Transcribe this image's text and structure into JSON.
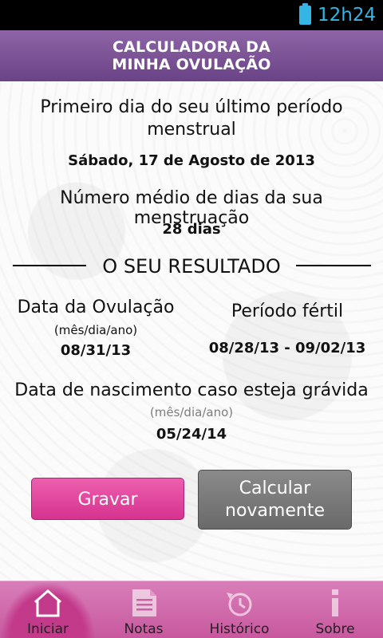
{
  "status_bar": {
    "time": "12h24"
  },
  "app": {
    "title_line1": "CALCULADORA DA",
    "title_line2": "MINHA OVULAÇÃO"
  },
  "input": {
    "last_period_label_line1": "Primeiro dia do seu último período",
    "last_period_label_line2": "menstrual",
    "last_period_value": "Sábado, 17 de Agosto de 2013",
    "cycle_label": "Número médio de dias da sua menstruação",
    "cycle_value": "28 dias"
  },
  "result": {
    "heading": "O SEU RESULTADO",
    "ovulation_label": "Data da Ovulação",
    "ovulation_format": "(mês/dia/ano)",
    "ovulation_value": "08/31/13",
    "fertile_label": "Período fértil",
    "fertile_value": "08/28/13 - 09/02/13",
    "birth_label": "Data de nascimento caso esteja grávida",
    "birth_format": "(mês/dia/ano)",
    "birth_value": "05/24/14"
  },
  "buttons": {
    "save": "Gravar",
    "recalc_line1": "Calcular",
    "recalc_line2": "novamente"
  },
  "nav": [
    {
      "label": "Iniciar",
      "icon": "home-icon"
    },
    {
      "label": "Notas",
      "icon": "notes-icon"
    },
    {
      "label": "Histórico",
      "icon": "history-icon"
    },
    {
      "label": "Sobre",
      "icon": "info-icon"
    }
  ],
  "colors": {
    "title_bar": "#7a519a",
    "save_button": "#e0479f",
    "recalc_button": "#7a7a7a",
    "nav_bar": "#d06aab",
    "status_accent": "#33b5e5"
  }
}
